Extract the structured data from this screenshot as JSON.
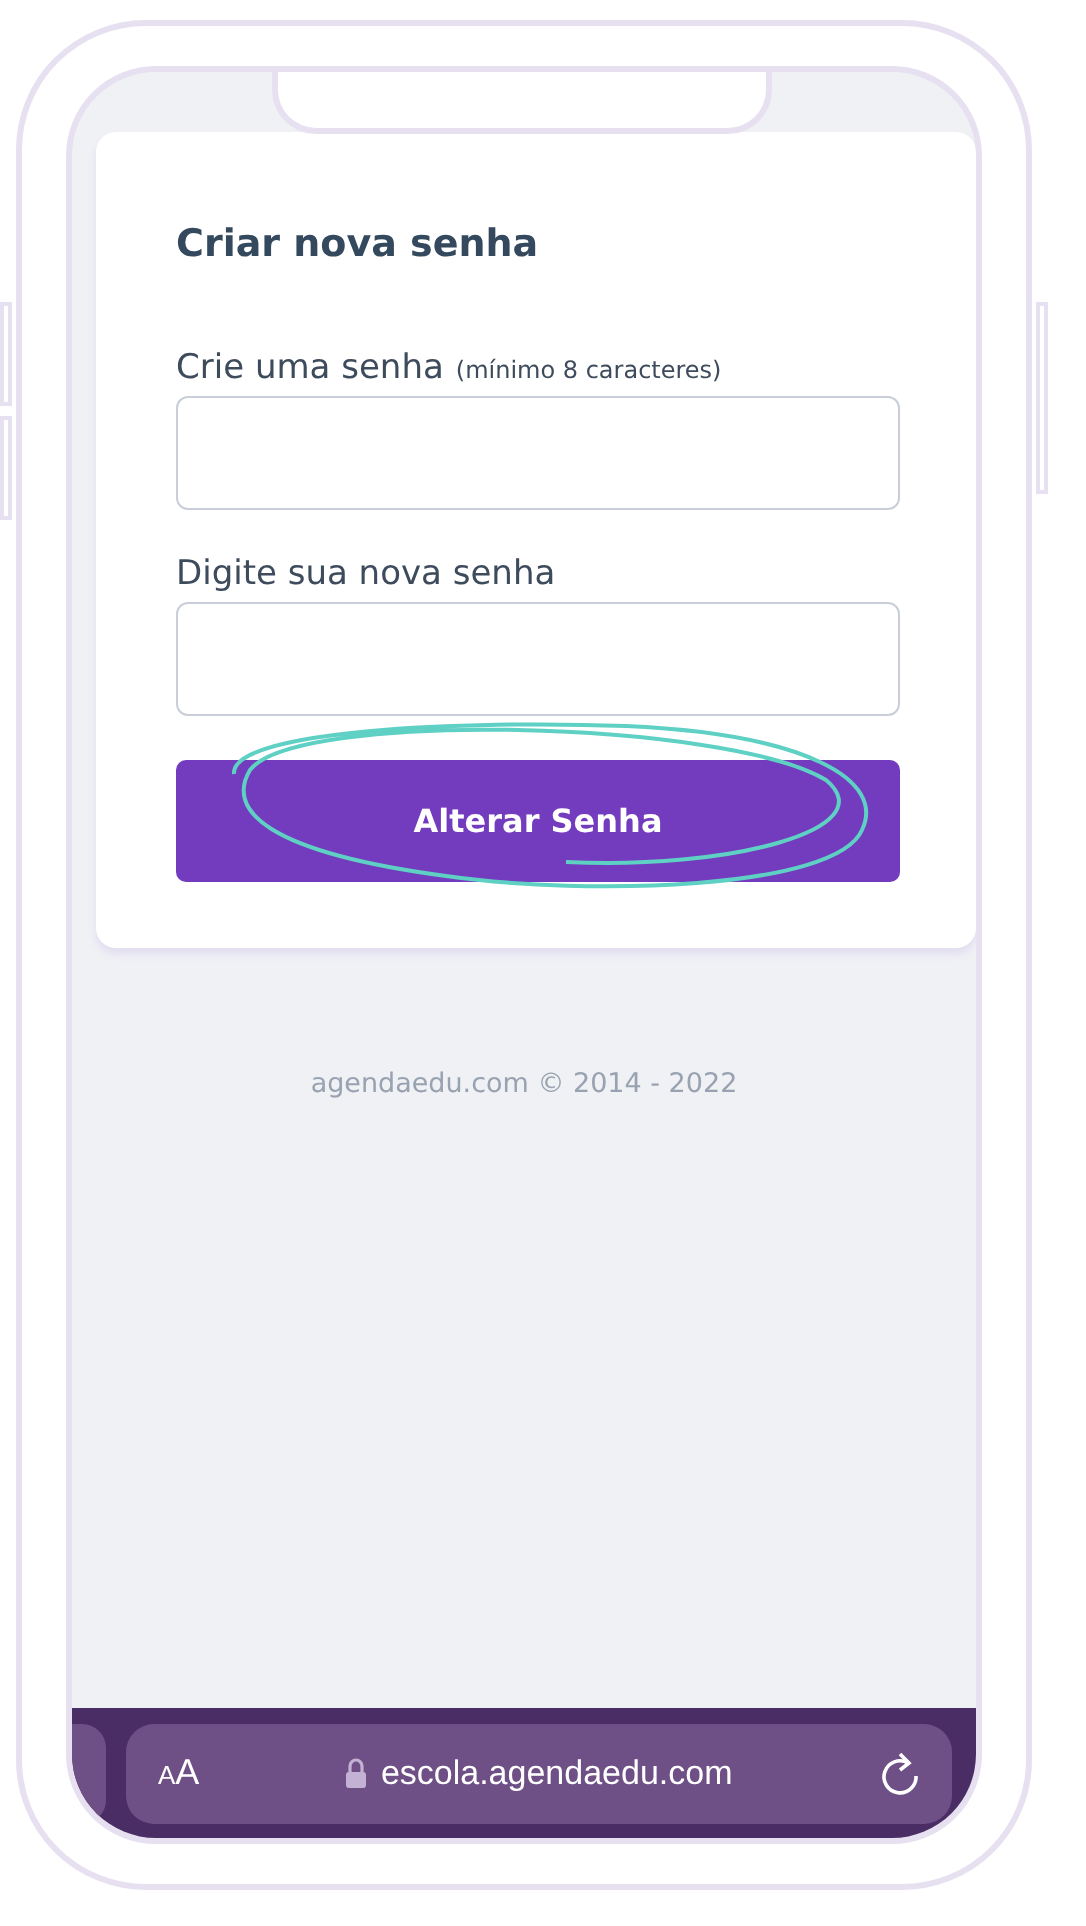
{
  "form": {
    "title": "Criar nova senha",
    "fields": [
      {
        "label": "Crie uma senha",
        "hint": "(mínimo 8 caracteres)"
      },
      {
        "label": "Digite sua nova senha"
      }
    ],
    "submit": {
      "label": "Alterar Senha",
      "circled": true
    }
  },
  "footer": "agendaedu.com © 2014 - 2022",
  "browser_bar": {
    "text_size": "AA",
    "url": "escola.agendaedu.com"
  }
}
